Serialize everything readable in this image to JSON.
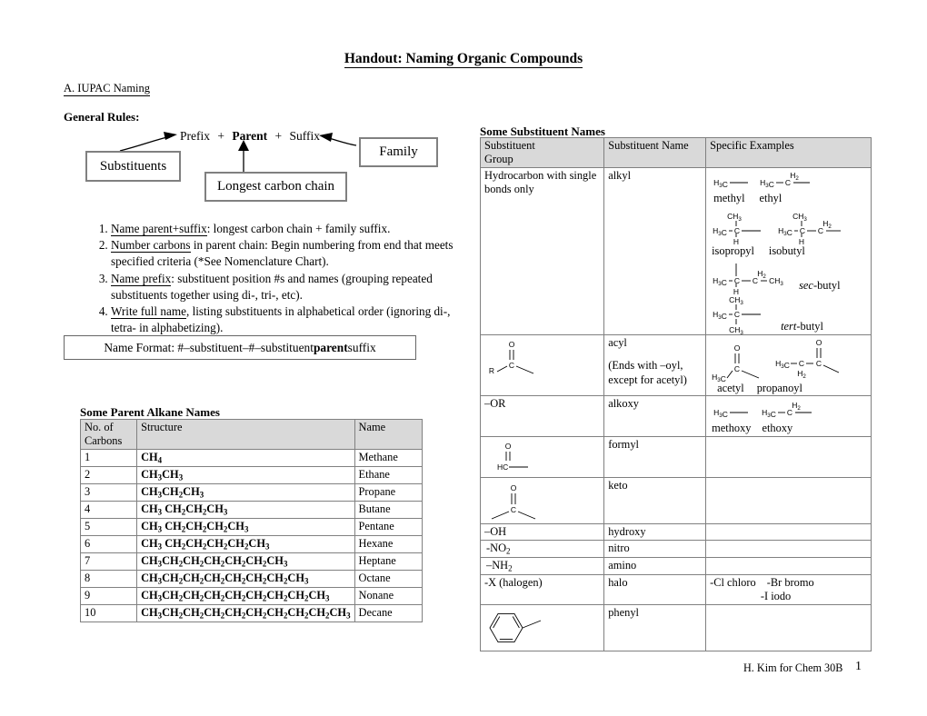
{
  "document": {
    "title": "Handout: Naming Organic Compounds",
    "section_a": "A. IUPAC Naming",
    "general_rules_heading": "General Rules:"
  },
  "flow_diagram": {
    "formula_prefix": "Prefix",
    "plus_1": "+",
    "formula_parent": "Parent",
    "plus_2": "+",
    "formula_suffix": "Suffix",
    "box_substituents": "Substituents",
    "box_longest_chain": "Longest carbon chain",
    "box_family": "Family"
  },
  "rules": [
    {
      "underlined": "Name parent+suffix",
      "rest": ": longest carbon chain + family suffix."
    },
    {
      "underlined": "Number carbons",
      "rest": " in parent chain: Begin numbering from end that meets specified criteria (*See Nomenclature Chart)."
    },
    {
      "underlined": "Name prefix",
      "rest": ": substituent position #s and names (grouping repeated substituents together using di-, tri-, etc)."
    },
    {
      "underlined": "Write full name",
      "rest": ", listing substituents in alphabetical order (ignoring di-, tetra- in alphabetizing)."
    }
  ],
  "name_format": {
    "prefix_text": "Name Format: #–substituent–#–substituent",
    "bold_text": "parent",
    "suffix_text": "suffix"
  },
  "alkane_table": {
    "caption": "Some Parent Alkane Names",
    "headers": [
      "No. of Carbons",
      "Structure",
      "Name"
    ],
    "rows": [
      {
        "carbons": "1",
        "structure": "CH4",
        "name": "Methane"
      },
      {
        "carbons": "2",
        "structure": "CH3CH3",
        "name": "Ethane"
      },
      {
        "carbons": "3",
        "structure": "CH3CH2CH3",
        "name": "Propane"
      },
      {
        "carbons": "4",
        "structure": "CH3 CH2CH2CH3",
        "name": "Butane"
      },
      {
        "carbons": "5",
        "structure": "CH3 CH2CH2CH2CH3",
        "name": "Pentane"
      },
      {
        "carbons": "6",
        "structure": "CH3 CH2CH2CH2CH2CH3",
        "name": "Hexane"
      },
      {
        "carbons": "7",
        "structure": "CH3CH2CH2CH2CH2CH2CH3",
        "name": "Heptane"
      },
      {
        "carbons": "8",
        "structure": "CH3CH2CH2CH2CH2CH2CH2CH3",
        "name": "Octane"
      },
      {
        "carbons": "9",
        "structure": "CH3CH2CH2CH2CH2CH2CH2CH2CH3",
        "name": "Nonane"
      },
      {
        "carbons": "10",
        "structure": "CH3CH2CH2CH2CH2CH2CH2CH2CH2CH3",
        "name": "Decane"
      }
    ]
  },
  "substituent_table": {
    "caption": "Some Substituent Names",
    "headers": [
      "Substituent Group",
      "Substituent Name",
      "Specific Examples"
    ],
    "rows": [
      {
        "group": "Hydrocarbon with single bonds only",
        "group_kind": "text",
        "name": "alkyl",
        "name_note": "",
        "examples_kind": "alkyl-structures",
        "example_labels": [
          "methyl",
          "ethyl",
          "isopropyl",
          "isobutyl",
          "sec-butyl",
          "tert-butyl"
        ]
      },
      {
        "group": "",
        "group_kind": "acyl-R-structure",
        "name": "acyl",
        "name_note": "(Ends with –oyl, except for acetyl)",
        "examples_kind": "acyl-structures",
        "example_labels": [
          "acetyl",
          "propanoyl"
        ]
      },
      {
        "group": "–OR",
        "group_kind": "text",
        "name": "alkoxy",
        "name_note": "",
        "examples_kind": "alkoxy-structures",
        "example_labels": [
          "methoxy",
          "ethoxy"
        ]
      },
      {
        "group": "",
        "group_kind": "formyl-structure",
        "name": "formyl",
        "name_note": "",
        "examples_kind": "none",
        "example_labels": []
      },
      {
        "group": "",
        "group_kind": "keto-structure",
        "name": "keto",
        "name_note": "",
        "examples_kind": "none",
        "example_labels": []
      },
      {
        "group": "–OH",
        "group_kind": "text",
        "name": "hydroxy",
        "name_note": "",
        "examples_kind": "none",
        "example_labels": []
      },
      {
        "group": "-NO2",
        "group_kind": "text-sub",
        "name": "nitro",
        "name_note": "",
        "examples_kind": "none",
        "example_labels": []
      },
      {
        "group": "–NH2",
        "group_kind": "text-sub",
        "name": "amino",
        "name_note": "",
        "examples_kind": "none",
        "example_labels": []
      },
      {
        "group": "-X (halogen)",
        "group_kind": "text",
        "name": "halo",
        "name_note": "",
        "examples_kind": "halo-text",
        "example_labels": [
          "-Cl chloro",
          "-Br bromo",
          "-I  iodo"
        ]
      },
      {
        "group": "",
        "group_kind": "phenyl-structure",
        "name": "phenyl",
        "name_note": "",
        "examples_kind": "none",
        "example_labels": []
      }
    ]
  },
  "structure_atom_labels": {
    "h3c": "H3C",
    "c": "C",
    "h": "H",
    "h2": "H2",
    "ch3": "CH3",
    "o": "O",
    "r": "R",
    "hc": "HC"
  },
  "footer": {
    "credit": "H. Kim for Chem 30B",
    "page_number": "1"
  },
  "colors": {
    "header_fill": "#d9d9d9",
    "border": "#808080",
    "box_border": "#808080",
    "text": "#000000"
  }
}
